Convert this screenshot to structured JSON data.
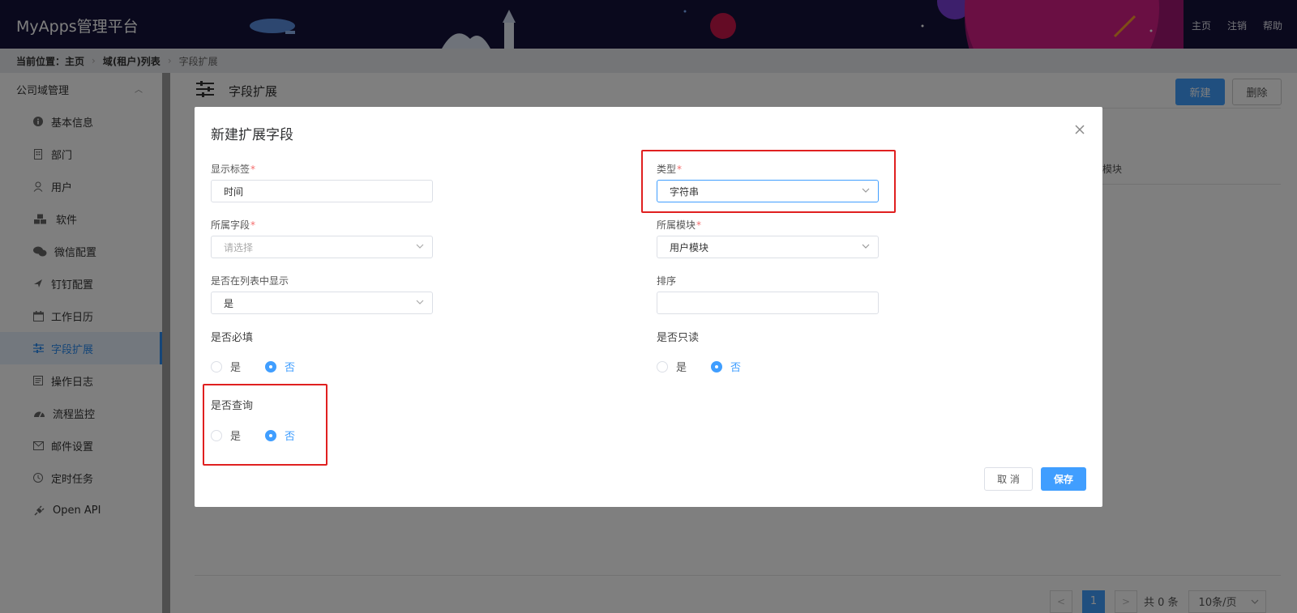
{
  "header": {
    "brand": "MyApps管理平台",
    "nav": [
      "主页",
      "注销",
      "帮助"
    ]
  },
  "breadcrumb": {
    "prefix": "当前位置：主页",
    "level2": "域(租户)列表",
    "current": "字段扩展"
  },
  "sidebar": {
    "group": "公司域管理",
    "items": [
      {
        "label": "基本信息",
        "icon": "info-icon"
      },
      {
        "label": "部门",
        "icon": "building-icon"
      },
      {
        "label": "用户",
        "icon": "user-icon"
      },
      {
        "label": "软件",
        "icon": "cubes-icon"
      },
      {
        "label": "微信配置",
        "icon": "wechat-icon"
      },
      {
        "label": "钉钉配置",
        "icon": "plane-icon"
      },
      {
        "label": "工作日历",
        "icon": "calendar-icon"
      },
      {
        "label": "字段扩展",
        "icon": "sliders-icon",
        "active": true
      },
      {
        "label": "操作日志",
        "icon": "log-icon"
      },
      {
        "label": "流程监控",
        "icon": "dashboard-icon"
      },
      {
        "label": "邮件设置",
        "icon": "mail-icon"
      },
      {
        "label": "定时任务",
        "icon": "clock-icon"
      },
      {
        "label": "Open API",
        "icon": "plug-icon"
      }
    ]
  },
  "main": {
    "title": "字段扩展",
    "new_label": "新建",
    "delete_label": "删除",
    "column_partial": "模块",
    "pager": {
      "prev": "<",
      "page": "1",
      "next": ">",
      "total": "共 0 条",
      "page_size": "10条/页"
    }
  },
  "dialog": {
    "title": "新建扩展字段",
    "display_label": {
      "label": "显示标签",
      "value": "时间"
    },
    "type": {
      "label": "类型",
      "value": "字符串"
    },
    "owner_field": {
      "label": "所属字段",
      "placeholder": "请选择"
    },
    "owner_module": {
      "label": "所属模块",
      "value": "用户模块"
    },
    "show_in_list": {
      "label": "是否在列表中显示",
      "value": "是"
    },
    "sort": {
      "label": "排序",
      "value": ""
    },
    "required": {
      "label": "是否必填",
      "yes": "是",
      "no": "否",
      "selected": "否"
    },
    "readonly": {
      "label": "是否只读",
      "yes": "是",
      "no": "否",
      "selected": "否"
    },
    "query": {
      "label": "是否查询",
      "yes": "是",
      "no": "否",
      "selected": "否"
    },
    "cancel_label": "取 消",
    "save_label": "保存"
  },
  "colors": {
    "primary": "#409eff",
    "header_bg": "#14123a",
    "highlight": "#e02020",
    "required_mark": "#f56c6c"
  }
}
